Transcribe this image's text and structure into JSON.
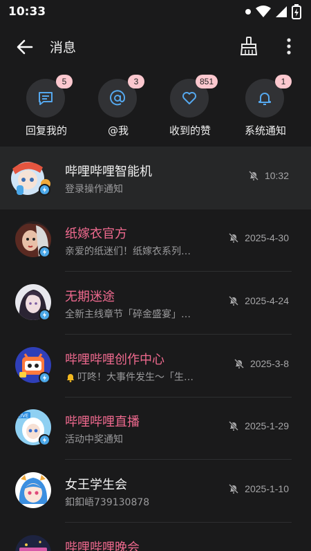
{
  "status": {
    "time": "10:33"
  },
  "header": {
    "title": "消息"
  },
  "categories": [
    {
      "label": "回复我的",
      "badge": "5"
    },
    {
      "label": "@我",
      "badge": "3"
    },
    {
      "label": "收到的赞",
      "badge": "851"
    },
    {
      "label": "系统通知",
      "badge": "1"
    }
  ],
  "messages": [
    {
      "title": "哔哩哔哩智能机",
      "subtitle": "登录操作通知",
      "time": "10:32"
    },
    {
      "title": "纸嫁衣官方",
      "subtitle": "亲爱的纸迷们！纸嫁衣系列…",
      "time": "2025-4-30"
    },
    {
      "title": "无期迷途",
      "subtitle": "全新主线章节「碎金盛宴」…",
      "time": "2025-4-24"
    },
    {
      "title": "哔哩哔哩创作中心",
      "subtitle": "叮咚！大事件发生～「生…",
      "time": "2025-3-8"
    },
    {
      "title": "哔哩哔哩直播",
      "subtitle": "活动中奖通知",
      "time": "2025-1-29"
    },
    {
      "title": "女王学生会",
      "subtitle": "釦釦峿739130878",
      "time": "2025-1-10"
    },
    {
      "title": "哔哩哔哩晚会",
      "subtitle": "",
      "time": ""
    }
  ],
  "colors": {
    "background": "#1a1a1b",
    "accent_pink": "#f06a8f",
    "badge": "#fcc8cf",
    "verify_blue": "#4aa7e8"
  },
  "icons": {
    "back": "arrow-left-icon",
    "clean": "broom-icon",
    "more": "more-vertical-icon",
    "mute": "bell-off-icon"
  }
}
